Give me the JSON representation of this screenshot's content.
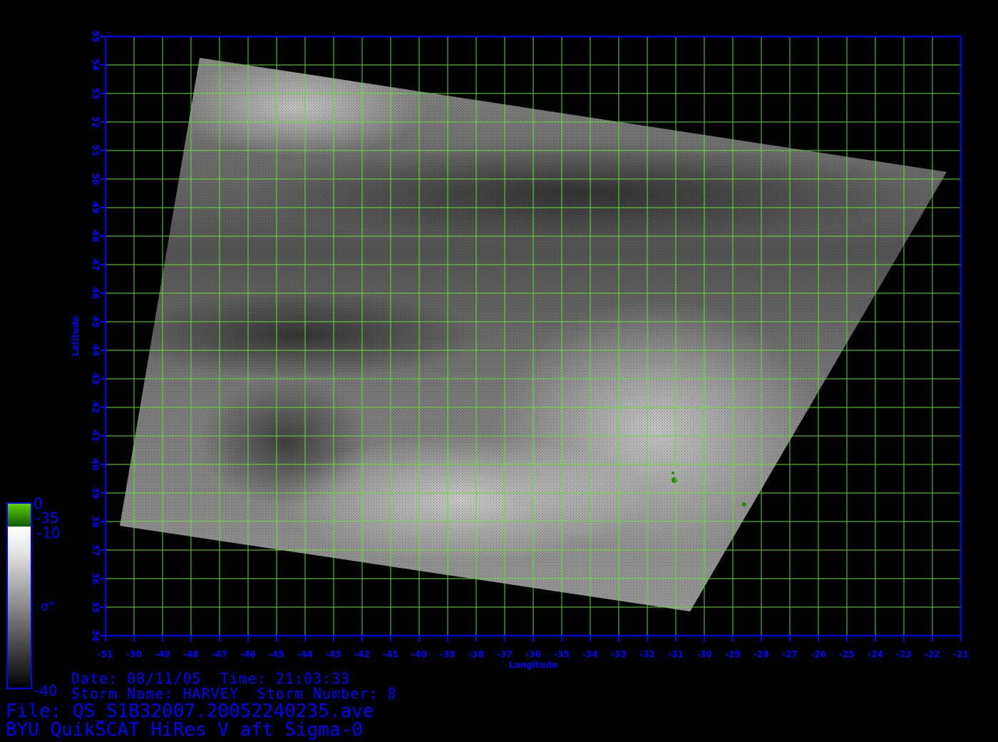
{
  "map": {
    "xlabel": "Longitude",
    "ylabel": "Latitude",
    "lon_range": [
      -51,
      -21
    ],
    "lat_range": [
      34,
      55
    ],
    "lon_ticks": [
      "-51",
      "-50",
      "-49",
      "-48",
      "-47",
      "-46",
      "-45",
      "-44",
      "-43",
      "-42",
      "-41",
      "-40",
      "-39",
      "-38",
      "-37",
      "-36",
      "-35",
      "-34",
      "-33",
      "-32",
      "-31",
      "-30",
      "-29",
      "-28",
      "-27",
      "-26",
      "-25",
      "-24",
      "-23",
      "-22",
      "-21"
    ],
    "lat_ticks": [
      "34",
      "35",
      "36",
      "37",
      "38",
      "39",
      "40",
      "41",
      "42",
      "43",
      "44",
      "45",
      "46",
      "47",
      "48",
      "49",
      "50",
      "51",
      "52",
      "53",
      "54",
      "55"
    ],
    "grid": true,
    "colors": {
      "grid": "#66dd33",
      "axis": "#0000ff",
      "land_mask": "#2a8a00",
      "background": "#000000"
    }
  },
  "swath": {
    "corners_lonlat": [
      [
        -47.7,
        54.25
      ],
      [
        -21.5,
        50.25
      ],
      [
        -30.5,
        34.85
      ],
      [
        -50.5,
        37.85
      ]
    ]
  },
  "colorbar": {
    "labels": [
      "0",
      "-35",
      "-10",
      "σ°",
      "-40"
    ]
  },
  "footer": {
    "date_label": "Date:",
    "date": "08/11/05",
    "time_label": "Time:",
    "time": "21:03:33",
    "storm_name_label": "Storm Name:",
    "storm_name": "HARVEY",
    "storm_number_label": "Storm Number:",
    "storm_number": "8",
    "file_label": "File:",
    "file": "QS_S1B32007.20052240235.ave",
    "product": "BYU QuikSCAT HiRes V aft Sigma-0"
  }
}
